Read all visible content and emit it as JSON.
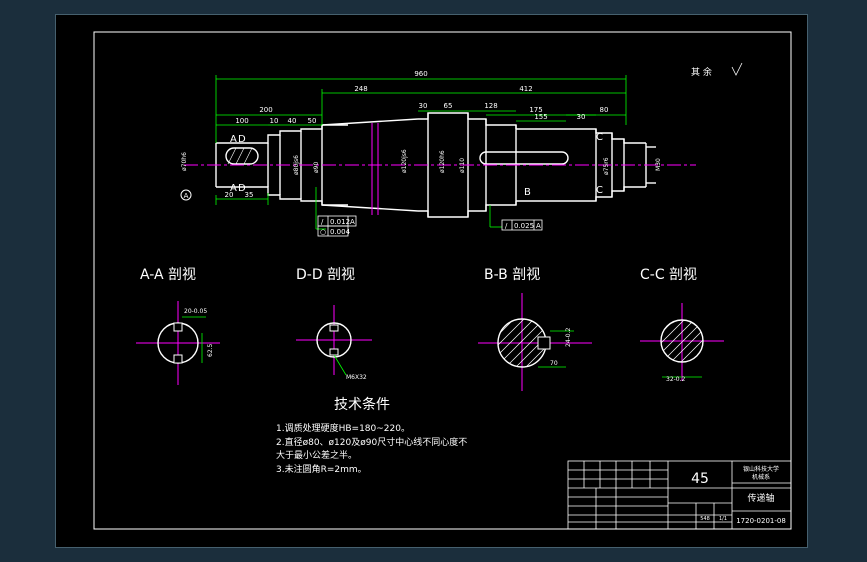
{
  "dims": {
    "overall": "960",
    "left_seg": "200",
    "a1": "100",
    "a2": "10",
    "a3": "40",
    "a4": "50",
    "mid": "248",
    "b1": "30",
    "b2": "65",
    "b3": "128",
    "right": "412",
    "c1": "175",
    "c2": "155",
    "c3": "30",
    "c4": "80",
    "d20": "20",
    "d35": "35"
  },
  "roughness_note": "其 余",
  "section_markers": {
    "A_top": "A",
    "A_bot": "A",
    "D_top": "D",
    "D_bot": "D",
    "B": "B",
    "C_top": "C",
    "C_bot": "C",
    "datum": "A"
  },
  "diameters": {
    "d1": "ø70h6",
    "d2": "ø80js6",
    "d3": "ø90",
    "d4": "ø120js6",
    "d5": "ø120h6",
    "d6": "ø110",
    "d7": "ø75r6",
    "d8": "M30"
  },
  "tolerance": {
    "t1_sym": "/",
    "t1_val": "0.012",
    "t1_ref": "A",
    "t2_sym": "○",
    "t2_val": "0.004",
    "t3_sym": "/",
    "t3_val": "0.025",
    "t3_ref": "A"
  },
  "sections": {
    "aa": "A-A 剖视",
    "dd": "D-D 剖视",
    "bb": "B-B 剖视",
    "cc": "C-C 剖视"
  },
  "section_dims": {
    "aa_w": "20-0.05",
    "aa_d": "62.5",
    "dd_note": "M6X32",
    "bb_d": "24-0.2",
    "bb_w": "70",
    "cc_d": "32-0.2"
  },
  "tech": {
    "title": "技术条件",
    "line1": "1.调质处理硬度HB=180~220。",
    "line2": "2.直径ø80、ø120及ø90尺寸中心线不同心度不",
    "line3": "大于最小公差之半。",
    "line4": "3.未注圆角R=2mm。"
  },
  "title_block": {
    "material": "45",
    "school": "银山科技大学",
    "school2": "机械系",
    "part_name": "传递轴",
    "drawing_no": "1720-0201-08",
    "scale": "1:5",
    "count": "548",
    "sheet": "1/1"
  },
  "colors": {
    "geometry": "#ffffff",
    "dimension": "#00ff00",
    "centerline": "#ff00ff",
    "text": "#00ffff",
    "hatch": "#ffffff"
  }
}
